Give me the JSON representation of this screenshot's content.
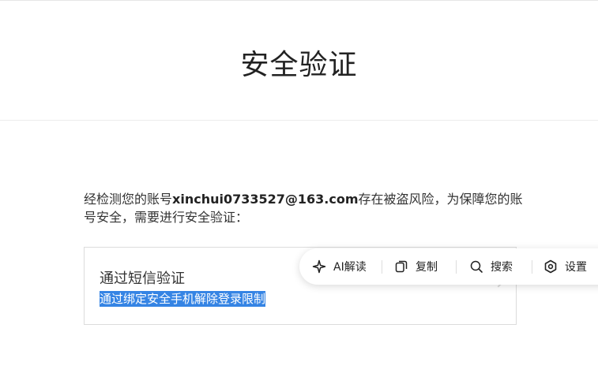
{
  "page": {
    "title": "安全验证"
  },
  "notice": {
    "prefix": "经检测您的账号",
    "account": "xinchui0733527@163.com",
    "suffix": "存在被盗风险，为保障您的账号安全，需要进行安全验证："
  },
  "verify_option": {
    "title": "通过短信验证",
    "description": "通过绑定安全手机解除登录限制"
  },
  "toolbar": {
    "ai_label": "AI解读",
    "copy_label": "复制",
    "search_label": "搜索",
    "settings_label": "设置",
    "icons": [
      "sparkle-icon",
      "copy-icon",
      "search-icon",
      "settings-icon"
    ]
  },
  "colors": {
    "selection": "#3584e4",
    "text": "#333333"
  }
}
